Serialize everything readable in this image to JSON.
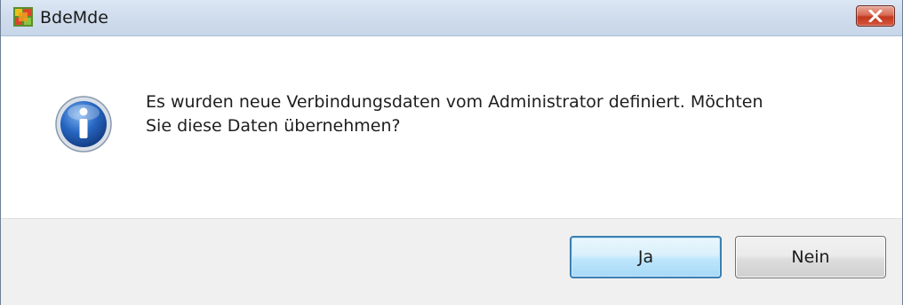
{
  "window": {
    "title": "BdeMde",
    "icon": "bdemde-app-icon",
    "close_icon": "close-icon"
  },
  "dialog": {
    "icon": "info-icon",
    "message_line1": "Es wurden neue Verbindungsdaten vom Administrator definiert. Möchten",
    "message_line2": "Sie diese Daten übernehmen?"
  },
  "buttons": {
    "yes_label": "Ja",
    "no_label": "Nein"
  },
  "colors": {
    "close_button": "#c2391f",
    "default_button_border": "#3c7fb1",
    "info_icon_blue": "#1f5fb8"
  }
}
